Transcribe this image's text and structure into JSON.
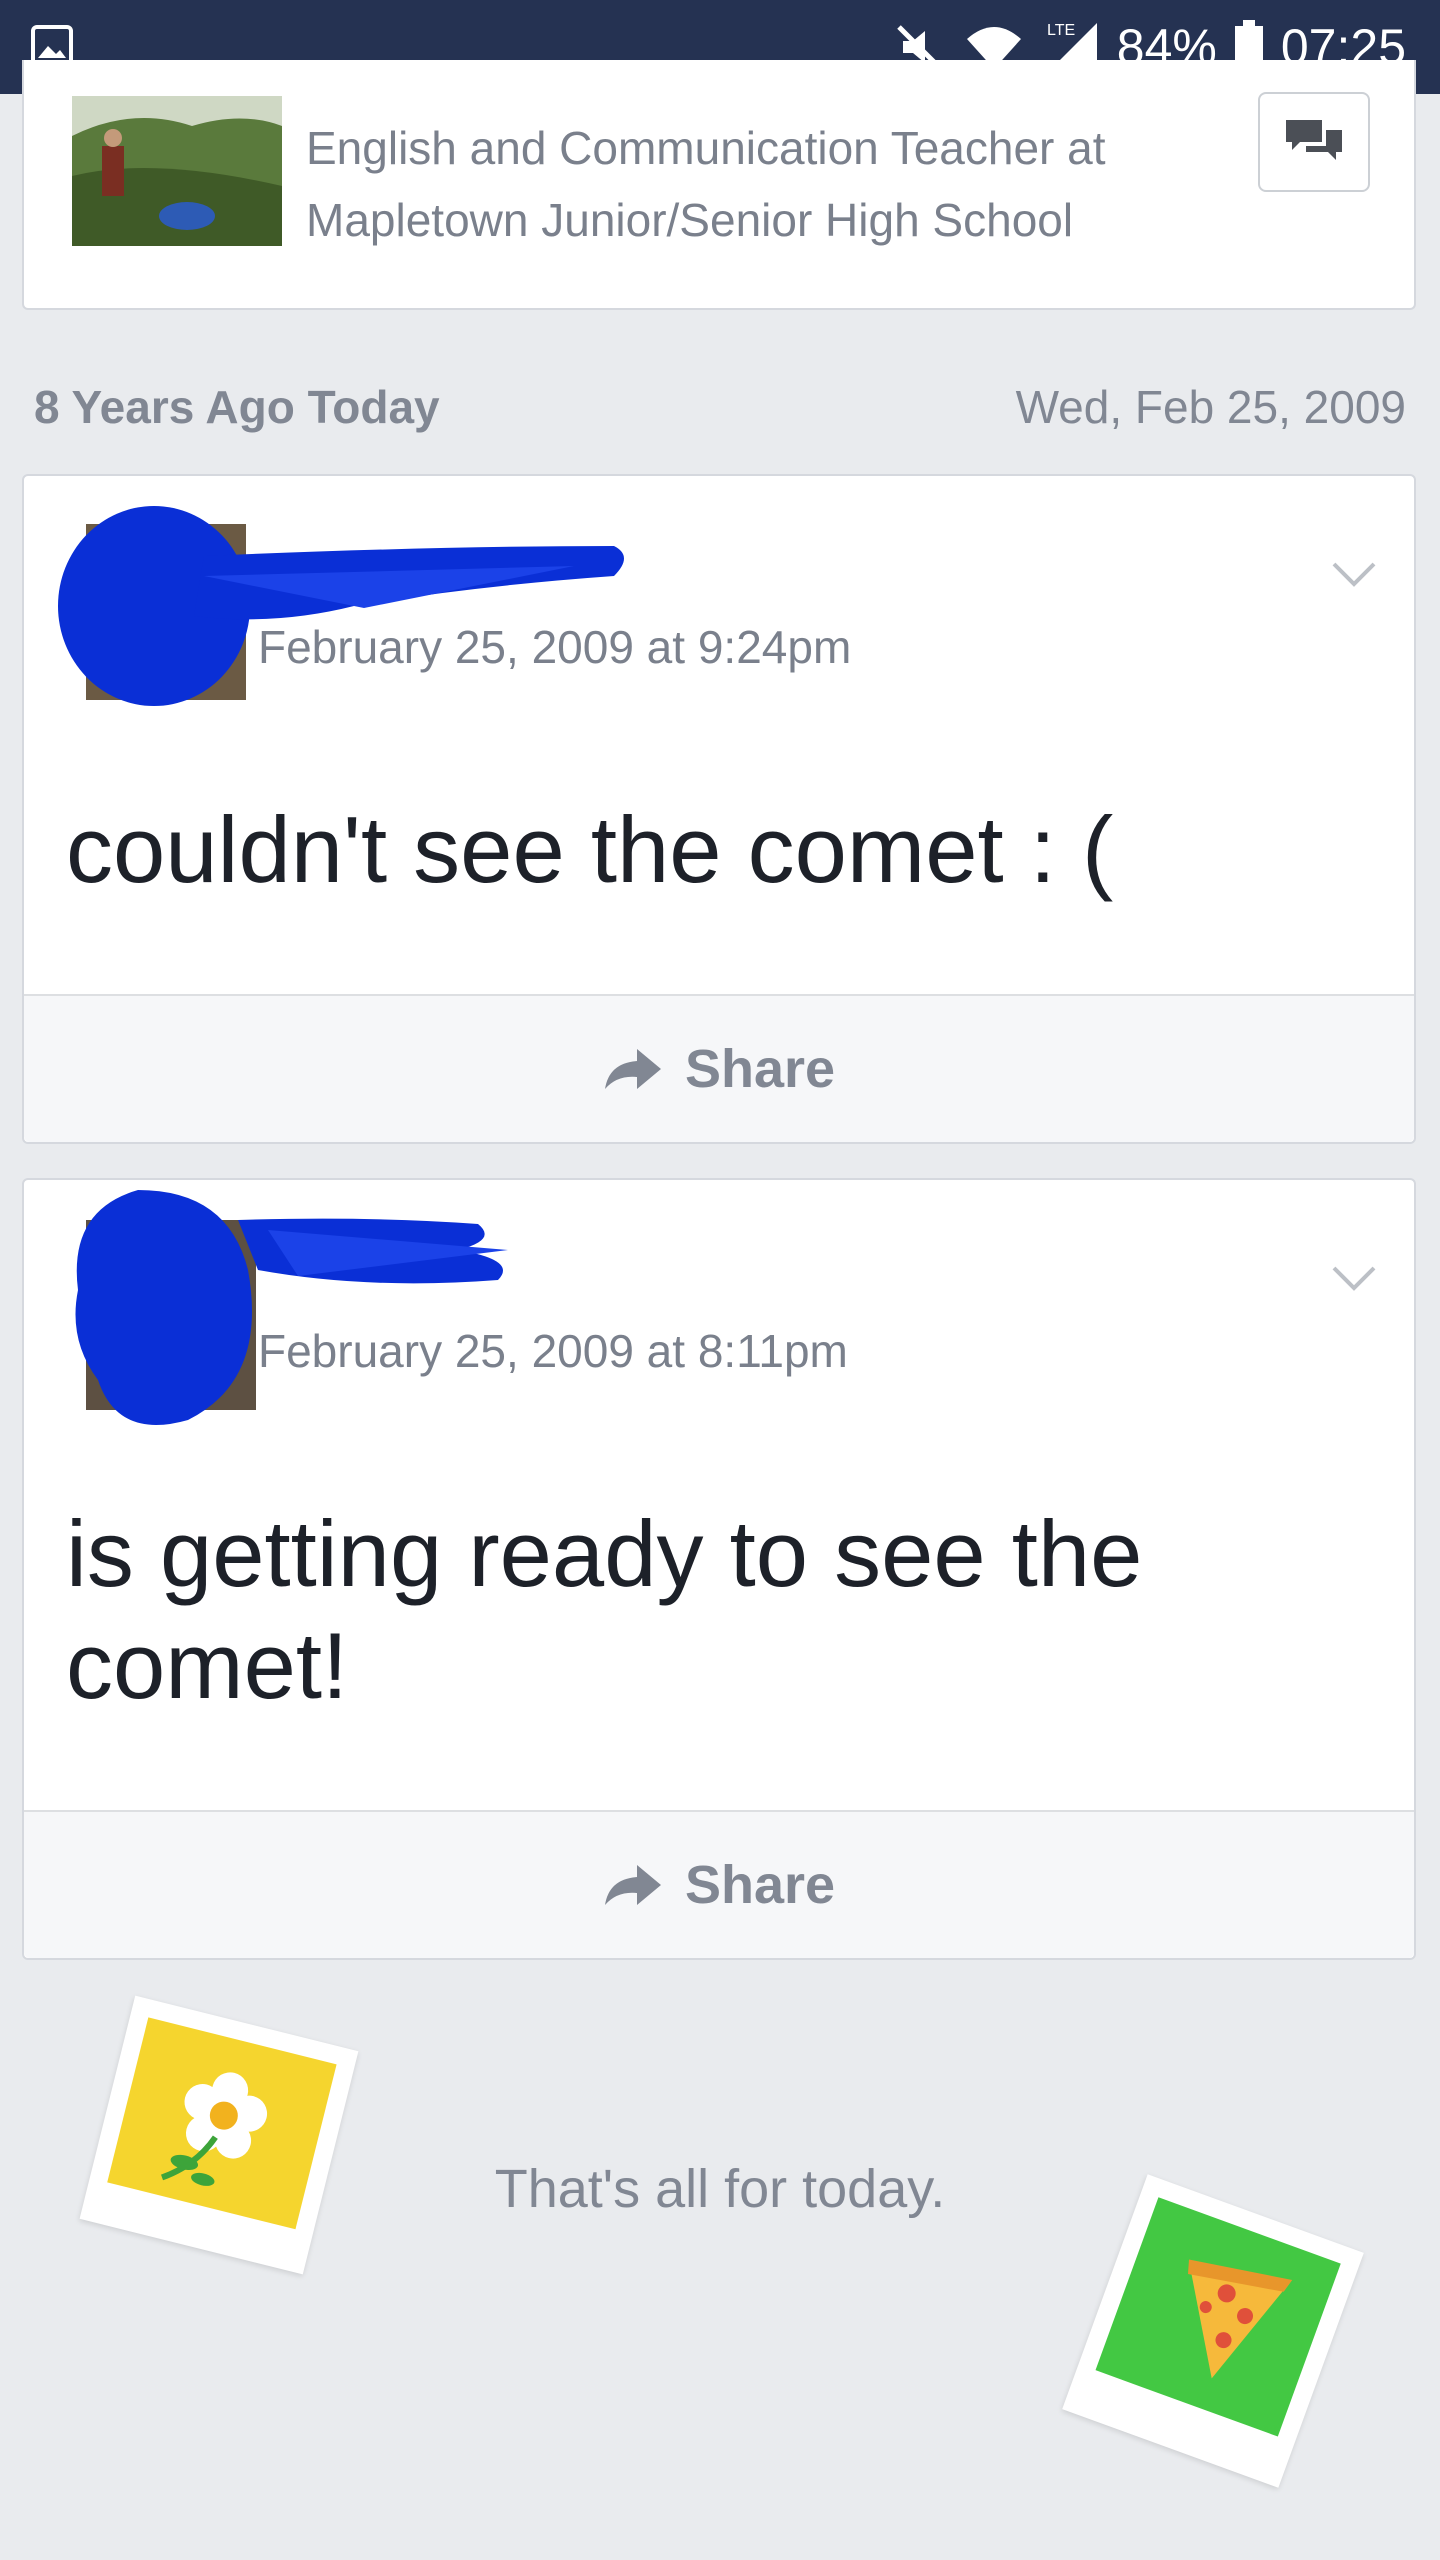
{
  "status_bar": {
    "battery_percent": "84%",
    "time": "07:25",
    "network": "LTE",
    "icons": [
      "gallery-icon",
      "mute-icon",
      "wifi-icon",
      "signal-icon",
      "battery-icon"
    ]
  },
  "profile": {
    "headline_line1": "English and Communication Teacher at",
    "headline_line2": "Mapletown Junior/Senior High School",
    "message_icon": "message-icon"
  },
  "section": {
    "title": "8 Years Ago Today",
    "date": "Wed, Feb 25, 2009"
  },
  "posts": [
    {
      "timestamp": "February 25, 2009 at 9:24pm",
      "text": "couldn't see the comet : (",
      "share_label": "Share"
    },
    {
      "timestamp": "February 25, 2009 at 8:11pm",
      "text": "is getting ready to see the comet!",
      "share_label": "Share"
    }
  ],
  "footer": {
    "text": "That's all for today."
  },
  "colors": {
    "status_bar": "#253252",
    "background": "#e9ebee",
    "redaction": "#0a2fd6",
    "muted_text": "#818793"
  }
}
